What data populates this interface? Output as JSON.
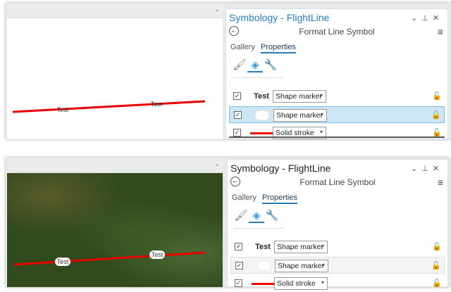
{
  "panels": [
    {
      "map_style": "blank",
      "pane": {
        "title": "Symbology - FlightLine",
        "subtitle": "Format Line Symbol",
        "tabs": [
          "Gallery",
          "Properties"
        ],
        "active_tab": "Properties",
        "layers": [
          {
            "preview": "Test",
            "type": "Shape marker",
            "checked": true,
            "selected": false
          },
          {
            "preview": "",
            "type": "Shape marker",
            "checked": true,
            "selected": true
          },
          {
            "preview": "",
            "type": "Solid stroke",
            "checked": true,
            "selected": false
          }
        ]
      },
      "labels": [
        "Test",
        "Test"
      ]
    },
    {
      "map_style": "satellite",
      "pane": {
        "title": "Symbology - FlightLine",
        "subtitle": "Format Line Symbol",
        "tabs": [
          "Gallery",
          "Properties"
        ],
        "active_tab": "Properties",
        "layers": [
          {
            "preview": "Test",
            "type": "Shape marker",
            "checked": true,
            "selected": false
          },
          {
            "preview": "",
            "type": "Shape marker",
            "checked": true,
            "selected": true
          },
          {
            "preview": "",
            "type": "Solid stroke",
            "checked": true,
            "selected": false
          }
        ]
      },
      "labels": [
        "Test",
        "Test"
      ]
    }
  ],
  "colors": {
    "line": "#e60000",
    "accent": "#2a7ab8"
  }
}
